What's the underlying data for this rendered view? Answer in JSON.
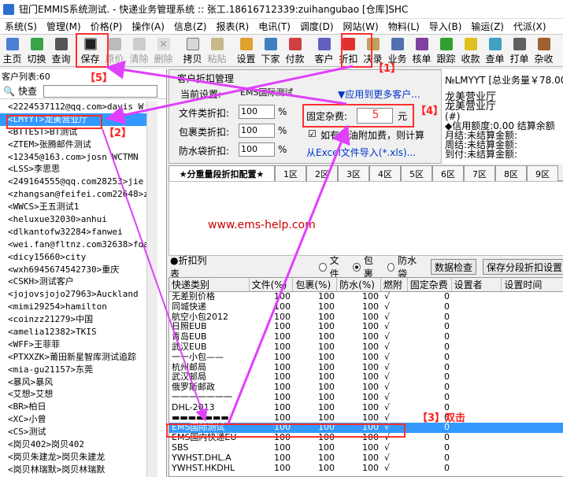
{
  "window": {
    "title": "钮门EMMIS系统测试. - 快递业务管理系统 :: 张工.18616712339:zuihangubao [仓库]SHC"
  },
  "menu": [
    "系统(S)",
    "管理(M)",
    "价格(P)",
    "操作(A)",
    "信息(Z)",
    "报表(R)",
    "电讯(T)",
    "调度(D)",
    "网站(W)",
    "物料(L)",
    "导入(B)",
    "输运(Z)",
    "代派(X)"
  ],
  "toolbar": {
    "home": "主页",
    "switch": "切换",
    "query": "查询",
    "save": "保存",
    "restore": "原价",
    "clear": "清除",
    "delete": "删除",
    "copy": "拷贝",
    "paste": "粘贴",
    "settings": "设置",
    "download": "下家",
    "payment": "付款",
    "customer": "客户",
    "discount": "折扣",
    "decision": "决录",
    "business": "业务",
    "approve": "核单",
    "track": "跟踪",
    "collect": "收款",
    "bill": "查单",
    "print": "打单",
    "misc": "杂收"
  },
  "left": {
    "header": "客户列表:60",
    "search_label": "快查",
    "customers": [
      "<2224537112@qq.com>davis W",
      "<LMYYT>龙美营业厅",
      "<BTTEST>BT测试",
      "<ZTEM>张腾邮件测试",
      "<12345@163.com>josn WCTMN",
      "<LSS>李思思",
      "<249164555@qq.com28253>jie BM",
      "<zhangsan@feifei.com22648>zha",
      "<WWCS>王五测试1",
      "<heluxue32030>anhui",
      "<dlkantofw32284>fanwei",
      "<wei.fan@fltnz.com32638>fdas",
      "<dicy15660>city",
      "<wxh6945674542730>重庆",
      "<CSKH>测试客户",
      "<jojovsjojo27963>Auckland",
      "<mimi29254>hamilton",
      "<coinzz21279>中国",
      "<amelia12382>TKIS",
      "<WFF>王菲菲",
      "<PTXXZK>莆田新星智库测试追踪",
      "<mia-gu21157>东莞",
      "<暴风>暴风",
      "<艾想>艾想",
      "<BR>柏日",
      "<XC>小曾",
      "<CS>测试",
      "<岗贝402>岗贝402",
      "<岗贝朱建龙>岗贝朱建龙",
      "<岗贝林瑞默>岗贝林瑞默"
    ]
  },
  "rate_panel": {
    "group_title": "客户折扣管理",
    "current_label": "当前设置:",
    "current_value": "EMS国际测试",
    "apply_more": "▼应用到更多客户...",
    "doc_label": "文件类折扣:",
    "doc_value": "100",
    "pkg_label": "包裹类折扣:",
    "pkg_value": "100",
    "waterproof_label": "防水袋折扣:",
    "waterproof_value": "100",
    "pct": "%",
    "fixed_label": "固定杂费:",
    "fixed_value": "5",
    "currency": "元",
    "fuel_check": "如有燃油附加费，则计算",
    "import_link": "从Excel文件导入(*.xls)..."
  },
  "tabs": [
    "★分重量段折扣配置★",
    "1区",
    "2区",
    "3区",
    "4区",
    "5区",
    "6区",
    "7区",
    "8区",
    "9区"
  ],
  "watermark": "www.ems-help.com",
  "list_header": {
    "title": "●折扣列表",
    "opt_doc": "文件",
    "opt_pkg": "包裹",
    "opt_water": "防水袋",
    "check_btn": "数据检查",
    "save_seg_btn": "保存分段折扣设置"
  },
  "table": {
    "columns": [
      "快递类别",
      "文件(%)",
      "包裹(%)",
      "防水(%)",
      "燃附",
      "固定杂费",
      "设置者",
      "设置时间"
    ],
    "rows": [
      [
        "无差别价格",
        "100",
        "100",
        "100",
        "√",
        "0"
      ],
      [
        "同城快递",
        "100",
        "100",
        "100",
        "√",
        "0"
      ],
      [
        "航空小包2012",
        "100",
        "100",
        "100",
        "√",
        "0"
      ],
      [
        "日照EUB",
        "100",
        "100",
        "100",
        "√",
        "0"
      ],
      [
        "青岛EUB",
        "100",
        "100",
        "100",
        "√",
        "0"
      ],
      [
        "武汉EUB",
        "100",
        "100",
        "100",
        "√",
        "0"
      ],
      [
        "一一小包——",
        "100",
        "100",
        "100",
        "√",
        "0"
      ],
      [
        "杭州邮局",
        "100",
        "100",
        "100",
        "√",
        "0"
      ],
      [
        "武汉邮局",
        "100",
        "100",
        "100",
        "√",
        "0"
      ],
      [
        "俄罗斯邮政",
        "100",
        "100",
        "100",
        "√",
        "0"
      ],
      [
        "一一一一一一一",
        "100",
        "100",
        "100",
        "√",
        "0"
      ],
      [
        "DHL-2013",
        "100",
        "100",
        "100",
        "√",
        "0"
      ],
      [
        "▬▬▬▬▬▬▬",
        "100",
        "100",
        "100",
        "√",
        "0"
      ],
      [
        "EMS国际测试",
        "100",
        "100",
        "100",
        "√",
        "0"
      ],
      [
        "EMS国内快递EU",
        "100",
        "100",
        "100",
        "√",
        "0"
      ],
      [
        "SBS",
        "100",
        "100",
        "100",
        "√",
        "0"
      ],
      [
        "YWHST.DHL.A",
        "100",
        "100",
        "100",
        "√",
        "0"
      ],
      [
        "YWHST.HKDHL",
        "100",
        "100",
        "100",
        "√",
        "0"
      ]
    ]
  },
  "side_info": {
    "code_line": "№LMYYT [总业务量￥78.00",
    "name1": "龙美营业厅",
    "name2": "龙美营业厅",
    "hash": "(#)",
    "credit": "◆信用额度:0.00 结算余额",
    "monthly": "月结:未结算金额:",
    "weekly": "周结:未结算金额:",
    "arrival": "到付:未结算金额:"
  },
  "annotations": {
    "a1": "【1】",
    "a2": "【2】",
    "a3": "【3】双击",
    "a4": "【4】",
    "a5": "【5】"
  },
  "colors": {
    "selection": "#3399ff",
    "annotation": "#ff3030",
    "arrow": "#e040fb"
  }
}
